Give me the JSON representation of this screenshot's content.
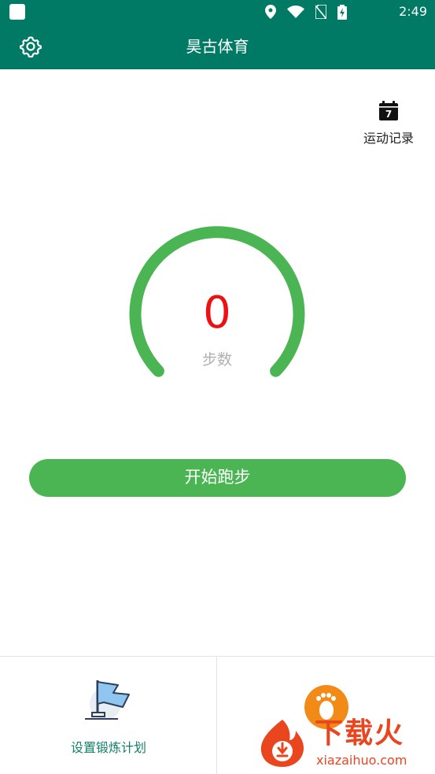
{
  "status_bar": {
    "time": "2:49"
  },
  "app_bar": {
    "title": "昊古体育"
  },
  "record": {
    "label": "运动记录",
    "calendar_day": "7"
  },
  "gauge": {
    "count": "0",
    "label": "步数",
    "color": "#4bb553"
  },
  "start_button": {
    "label": "开始跑步"
  },
  "bottom_nav": {
    "plan_label": "设置锻炼计划"
  },
  "watermark": {
    "brand": "下载火",
    "url": "xiazaihuo.com"
  },
  "colors": {
    "primary": "#007a65",
    "accent_green": "#4bb553",
    "count_red": "#ee1111",
    "watermark_red": "#e9451f"
  }
}
